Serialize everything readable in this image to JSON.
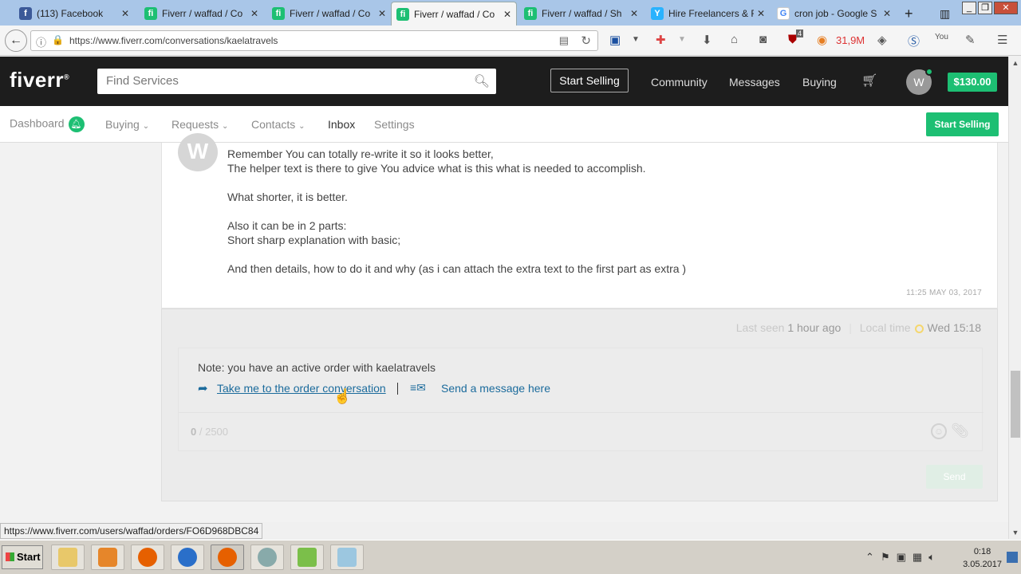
{
  "browser": {
    "tabs": [
      {
        "title": "(113) Facebook",
        "favicon": "facebook-icon",
        "color": "#3b5998",
        "active": false
      },
      {
        "title": "Fiverr / waffad / Co",
        "favicon": "fiverr-icon",
        "color": "#1dbf73",
        "active": false
      },
      {
        "title": "Fiverr / waffad / Co",
        "favicon": "fiverr-icon",
        "color": "#1dbf73",
        "active": false
      },
      {
        "title": "Fiverr / waffad / Co",
        "favicon": "fiverr-icon",
        "color": "#1dbf73",
        "active": true
      },
      {
        "title": "Fiverr / waffad / Sh",
        "favicon": "fiverr-icon",
        "color": "#1dbf73",
        "active": false
      },
      {
        "title": "Hire Freelancers & F",
        "favicon": "freelancer-icon",
        "color": "#29b2fe",
        "active": false
      },
      {
        "title": "cron job - Google S",
        "favicon": "google-icon",
        "color": "#ffffff",
        "active": false
      }
    ],
    "new_tab": "+",
    "url": "https://www.fiverr.com/conversations/kaelatravels",
    "extension_counter": "31,9M",
    "ublock_badge": "4"
  },
  "header": {
    "logo": "fiverr",
    "search_placeholder": "Find Services",
    "start_selling": "Start Selling",
    "links": [
      "Community",
      "Messages",
      "Buying"
    ],
    "avatar_letter": "W",
    "balance": "$130.00"
  },
  "subnav": {
    "items": [
      "Dashboard",
      "Buying",
      "Requests",
      "Contacts",
      "Inbox",
      "Settings"
    ],
    "active": "Inbox",
    "cta": "Start Selling"
  },
  "message": {
    "avatar_letter": "W",
    "lines": [
      "Remember You can totally re-write it so it looks better,",
      "The helper text is there to give You advice what is this what is needed to accomplish.",
      "What shorter, it is better.",
      "Also it can be in 2 parts:",
      "Short sharp explanation with basic;",
      "And then details, how to do it and why (as i can attach the extra text to the first part as extra )"
    ],
    "timestamp": "11:25  MAY 03, 2017"
  },
  "reply": {
    "last_seen_label": "Last seen",
    "last_seen_value": "1 hour ago",
    "local_time_label": "Local time",
    "local_time_value": "Wed 15:18",
    "note": "Note: you have an active order with kaelatravels",
    "order_link": "Take me to the order conversation",
    "send_link": "Send a message here",
    "counter_current": "0",
    "counter_max": "/ 2500",
    "send_button": "Send"
  },
  "status_url": "https://www.fiverr.com/users/waffad/orders/FO6D968DBC84",
  "taskbar": {
    "start": "Start",
    "time": "0:18",
    "date": "3.05.2017"
  }
}
